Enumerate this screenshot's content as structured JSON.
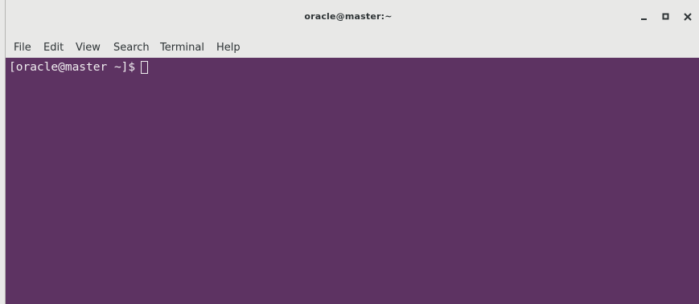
{
  "window": {
    "title": "oracle@master:~"
  },
  "controls": {
    "minimize_icon": "minimize-icon",
    "maximize_icon": "maximize-icon",
    "close_icon": "close-icon"
  },
  "menu": {
    "items": [
      {
        "label": "File"
      },
      {
        "label": "Edit"
      },
      {
        "label": "View"
      },
      {
        "label": "Search"
      },
      {
        "label": "Terminal"
      },
      {
        "label": "Help"
      }
    ]
  },
  "terminal": {
    "prompt": "[oracle@master ~]$ ",
    "background_color": "#5d3362",
    "text_color": "#f0eef0"
  }
}
